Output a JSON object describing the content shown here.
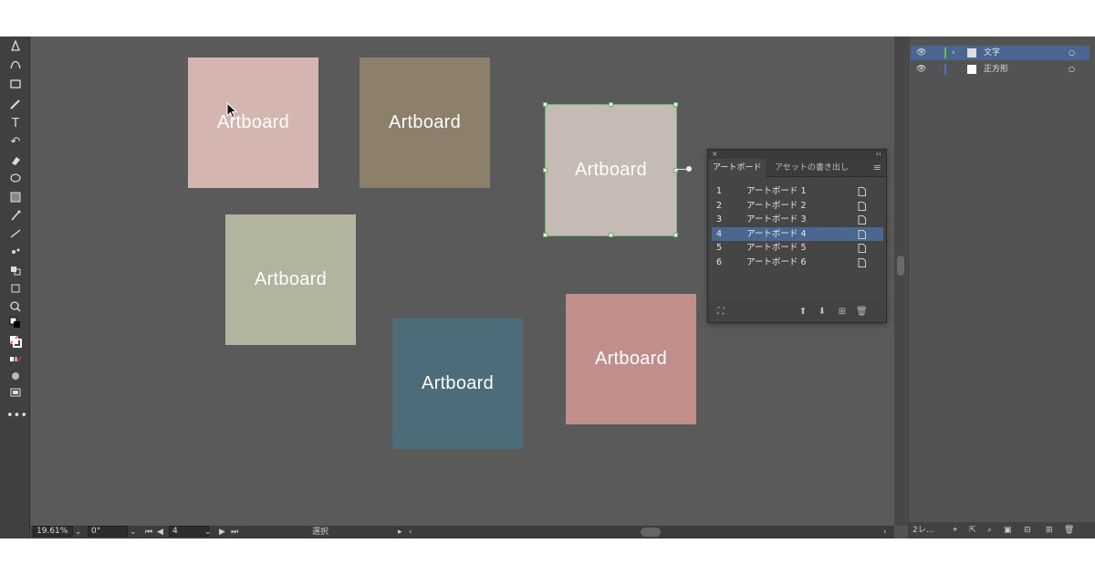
{
  "colors": {
    "artboard_1": "#d4b5b0",
    "artboard_2": "#8c7f6c",
    "artboard_3": "#c5bab4",
    "artboard_4": "#b2b49f",
    "artboard_5": "#4c6c79",
    "artboard_6": "#c18f8b",
    "selection": "#72b572",
    "selected_row": "#4b6790"
  },
  "artboards": [
    {
      "label": "Artboard"
    },
    {
      "label": "Artboard"
    },
    {
      "label": "Artboard"
    },
    {
      "label": "Artboard"
    },
    {
      "label": "Artboard"
    },
    {
      "label": "Artboard"
    }
  ],
  "artboards_panel": {
    "tabs": [
      "アートボード",
      "アセットの書き出し"
    ],
    "rows": [
      {
        "num": "1",
        "name": "アートボード 1"
      },
      {
        "num": "2",
        "name": "アートボード 2"
      },
      {
        "num": "3",
        "name": "アートボード 3"
      },
      {
        "num": "4",
        "name": "アートボード 4"
      },
      {
        "num": "5",
        "name": "アートボード 5"
      },
      {
        "num": "6",
        "name": "アートボード 6"
      }
    ],
    "selected_index": 3
  },
  "layers": [
    {
      "name": "文字"
    },
    {
      "name": "正方形"
    }
  ],
  "layers_footer": {
    "count": "2レ..."
  },
  "status": {
    "zoom": "19.61%",
    "rotation": "0°",
    "artboard_num": "4",
    "tool": "選択"
  }
}
